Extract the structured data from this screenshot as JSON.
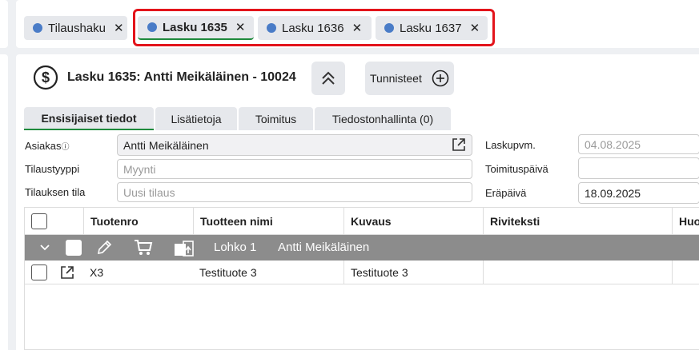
{
  "tabs": [
    {
      "label": "Tilaushaku",
      "active": false
    },
    {
      "label": "Lasku 1635",
      "active": true
    },
    {
      "label": "Lasku 1636",
      "active": false
    },
    {
      "label": "Lasku 1637",
      "active": false
    }
  ],
  "header": {
    "title": "Lasku 1635: Antti Meikäläinen - 10024",
    "tags_label": "Tunnisteet"
  },
  "subtabs": [
    "Ensisijaiset tiedot",
    "Lisätietoja",
    "Toimitus",
    "Tiedostonhallinta (0)"
  ],
  "form": {
    "customer_label": "Asiakas",
    "customer_value": "Antti Meikäläinen",
    "order_type_label": "Tilaustyyppi",
    "order_type_placeholder": "Myynti",
    "order_state_label": "Tilauksen tila",
    "order_state_placeholder": "Uusi tilaus",
    "invoice_date_label": "Laskupvm.",
    "invoice_date_value": "04.08.2025",
    "delivery_date_label": "Toimituspäivä",
    "delivery_date_value": "",
    "due_date_label": "Eräpäivä",
    "due_date_value": "18.09.2025"
  },
  "table": {
    "columns": [
      "Tuotenro",
      "Tuotteen nimi",
      "Kuvaus",
      "Riviteksti",
      "Huo"
    ],
    "group": {
      "block": "Lohko 1",
      "customer": "Antti Meikäläinen"
    },
    "rows": [
      {
        "product_no": "X3",
        "name": "Testituote 3",
        "description": "Testituote 3",
        "row_text": ""
      }
    ]
  },
  "colors": {
    "accent_dot": "#4a7cc7",
    "active_underline": "#1e8a3c",
    "highlight": "#e3141b",
    "group_bg": "#8c8c8c"
  }
}
